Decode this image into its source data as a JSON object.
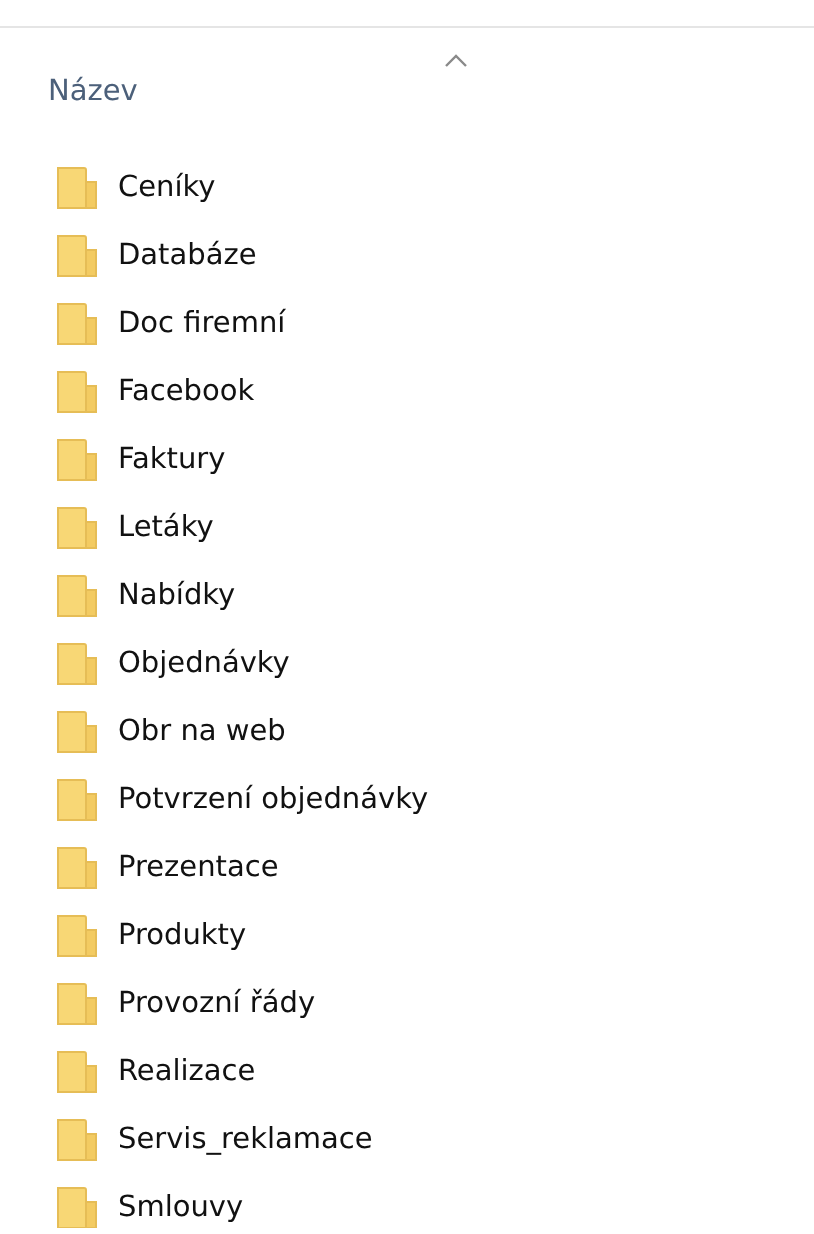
{
  "column_header": {
    "label": "Název"
  },
  "folders": [
    {
      "name": "Ceníky"
    },
    {
      "name": "Databáze"
    },
    {
      "name": "Doc firemní"
    },
    {
      "name": "Facebook"
    },
    {
      "name": "Faktury"
    },
    {
      "name": "Letáky"
    },
    {
      "name": "Nabídky"
    },
    {
      "name": "Objednávky"
    },
    {
      "name": "Obr na web"
    },
    {
      "name": "Potvrzení objednávky"
    },
    {
      "name": "Prezentace"
    },
    {
      "name": "Produkty"
    },
    {
      "name": "Provozní řády"
    },
    {
      "name": "Realizace"
    },
    {
      "name": "Servis_reklamace"
    },
    {
      "name": "Smlouvy"
    }
  ]
}
